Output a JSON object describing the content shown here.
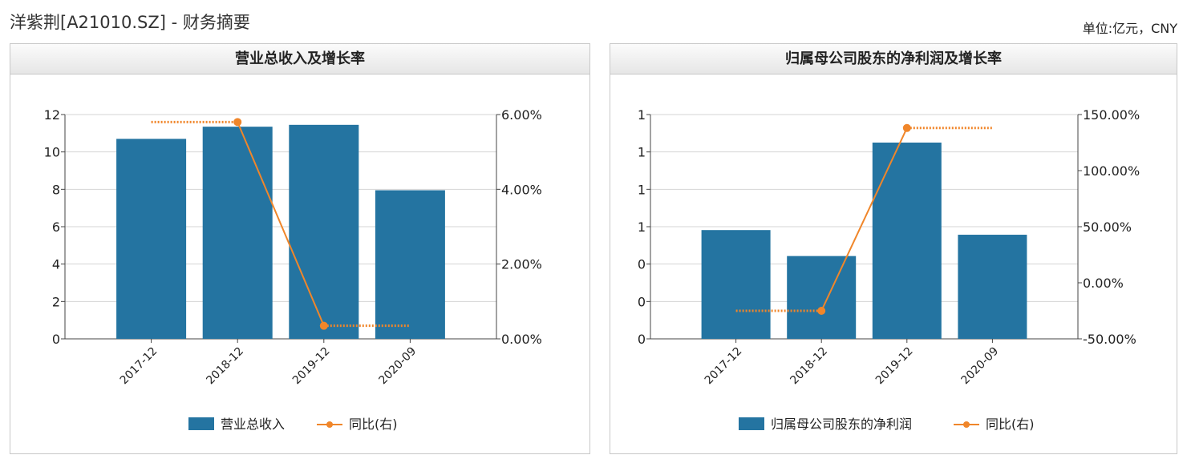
{
  "page": {
    "title": "洋紫荆[A21010.SZ] - 财务摘要",
    "unit": "单位:亿元，CNY"
  },
  "colors": {
    "bar": "#2474a1",
    "line": "#f0862a",
    "grid": "#d4d4d4",
    "axis": "#444444"
  },
  "chart_data": [
    {
      "type": "bar",
      "title": "营业总收入及增长率",
      "categories": [
        "2017-12",
        "2018-12",
        "2019-12",
        "2020-09"
      ],
      "series": [
        {
          "name": "营业总收入",
          "type": "bar",
          "axis": "left",
          "values": [
            10.7,
            11.35,
            11.45,
            7.95
          ]
        },
        {
          "name": "同比(右)",
          "type": "line",
          "axis": "right",
          "values": [
            null,
            5.8,
            0.35,
            null
          ],
          "flat_start": 5.8,
          "flat_end": 0.35
        }
      ],
      "left_axis": {
        "min": 0,
        "max": 12,
        "ticks": [
          "0",
          "2",
          "4",
          "6",
          "8",
          "10",
          "12"
        ]
      },
      "right_axis": {
        "min": 0,
        "max": 6,
        "ticks": [
          "0.00%",
          "2.00%",
          "4.00%",
          "6.00%"
        ]
      },
      "legend": [
        "营业总收入",
        "同比(右)"
      ]
    },
    {
      "type": "bar",
      "title": "归属母公司股东的净利润及增长率",
      "categories": [
        "2017-12",
        "2018-12",
        "2019-12",
        "2020-09"
      ],
      "series": [
        {
          "name": "归属母公司股东的净利润",
          "type": "bar",
          "axis": "left",
          "values": [
            0.582,
            0.443,
            1.05,
            0.557
          ]
        },
        {
          "name": "同比(右)",
          "type": "line",
          "axis": "right",
          "values": [
            null,
            -25,
            138,
            null
          ],
          "flat_start": -25,
          "flat_end": 138
        }
      ],
      "left_axis": {
        "min": 0,
        "max": 1.2,
        "ticks": [
          "0",
          "0",
          "0",
          "1",
          "1",
          "1",
          "1"
        ]
      },
      "right_axis": {
        "min": -50,
        "max": 150,
        "ticks": [
          "-50.00%",
          "0.00%",
          "50.00%",
          "100.00%",
          "150.00%"
        ]
      },
      "legend": [
        "归属母公司股东的净利润",
        "同比(右)"
      ]
    }
  ]
}
